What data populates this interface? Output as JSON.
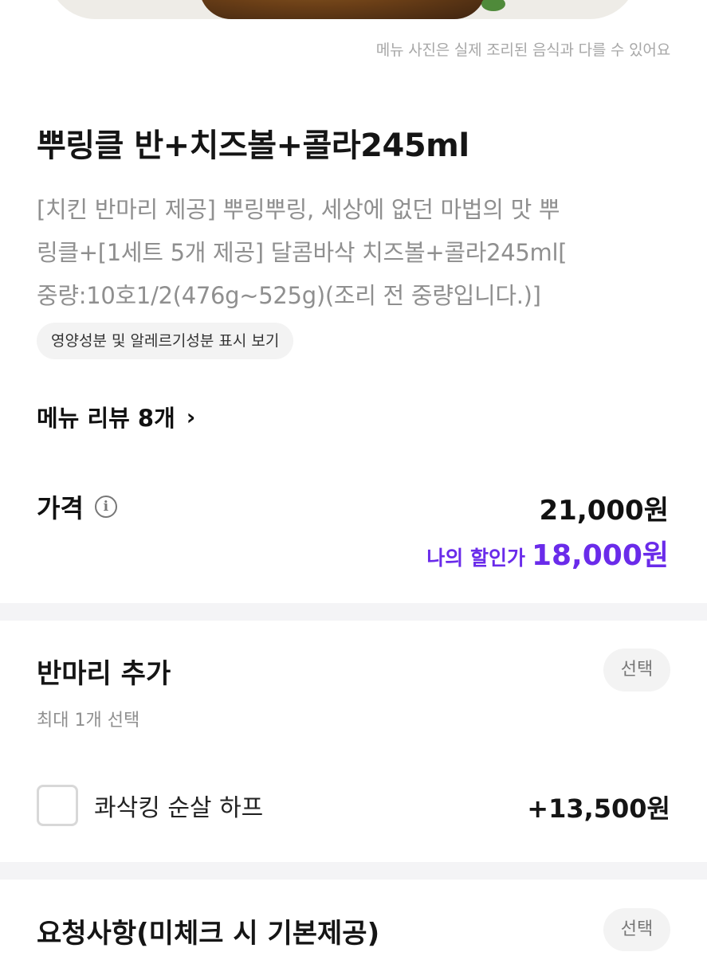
{
  "disclaimer": "메뉴 사진은 실제 조리된 음식과 다를 수 있어요",
  "menu": {
    "title": "뿌링클 반+치즈볼+콜라245ml",
    "description_lines": [
      "[치킨 반마리 제공] 뿌링뿌링, 세상에 없던 마법의 맛 뿌",
      "링클+[1세트 5개 제공] 달콤바삭 치즈볼+콜라245ml[",
      "중량:10호1/2(476g~525g)(조리 전 중량입니다.)]"
    ],
    "nutrition_label": "영양성분 및 알레르기성분 표시 보기",
    "review_label": "메뉴 리뷰 8개",
    "review_chevron": "›"
  },
  "price": {
    "label": "가격",
    "info_glyph": "i",
    "original": "21,000원",
    "discount_label": "나의 할인가",
    "discount_price": "18,000원",
    "accent_color": "#6a2bea"
  },
  "sections": [
    {
      "title": "반마리 추가",
      "select_label": "선택",
      "subtitle": "최대 1개 선택",
      "options": [
        {
          "name": "콰삭킹 순살 하프",
          "price": "+13,500원",
          "checked": false
        }
      ]
    },
    {
      "title": "요청사항(미체크 시 기본제공)",
      "select_label": "선택"
    }
  ],
  "icons": {
    "info": "info-circle-icon",
    "chevron": "chevron-right-icon",
    "checkbox": "checkbox-icon"
  }
}
